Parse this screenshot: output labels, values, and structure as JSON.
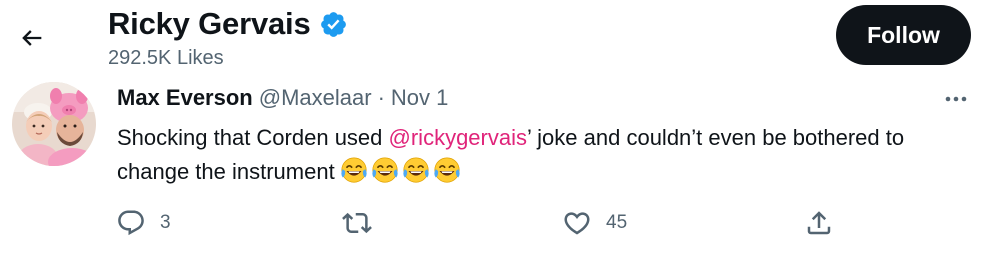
{
  "header": {
    "title": "Ricky Gervais",
    "likes": "292.5K Likes",
    "follow_label": "Follow",
    "back_icon": "arrow-left-icon",
    "verified_icon": "verified-badge-icon",
    "verified_color": "#1d9bf0"
  },
  "tweet": {
    "display_name": "Max Everson",
    "handle": "@Maxelaar",
    "separator": "·",
    "date": "Nov 1",
    "text_before": "Shocking that Corden used ",
    "mention": "@rickygervais",
    "text_after": "’ joke and couldn’t even be bothered to change the instrument",
    "emojis": [
      "😂",
      "😂",
      "😂",
      "😂"
    ],
    "more_icon": "more-horizontal-icon",
    "mention_color": "#e0247a"
  },
  "actions": {
    "reply_count": "3",
    "retweet_count": "",
    "like_count": "45",
    "share_count": ""
  }
}
